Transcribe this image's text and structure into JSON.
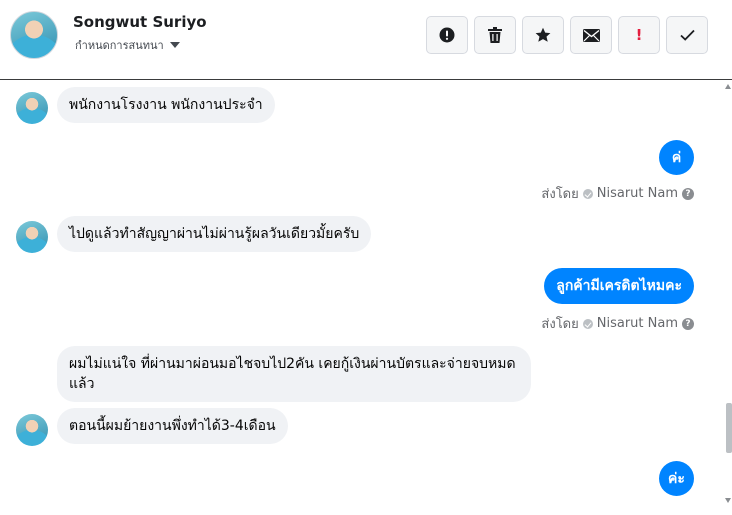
{
  "header": {
    "contact_name": "Songwut Suriyo",
    "subtitle": "กำหนดการสนทนา",
    "actions": [
      {
        "name": "report-button",
        "icon": "exclamation-circle-icon"
      },
      {
        "name": "delete-button",
        "icon": "trash-icon"
      },
      {
        "name": "star-button",
        "icon": "star-icon"
      },
      {
        "name": "mark-unread-button",
        "icon": "envelope-icon"
      },
      {
        "name": "flag-button",
        "icon": "exclamation-icon",
        "label": "!",
        "color": "#e41e3f"
      },
      {
        "name": "mark-done-button",
        "icon": "checkmark-icon"
      }
    ]
  },
  "messages": [
    {
      "from": "contact",
      "text": "พนักงานโรงงาน พนักงานประจำ"
    },
    {
      "from": "page",
      "text": "ค่"
    },
    {
      "from": "page_meta",
      "prefix": "ส่งโดย",
      "author": "Nisarut Nam"
    },
    {
      "from": "contact",
      "text": "ไปดูแล้วทำสัญญาผ่านไม่ผ่านรู้ผลวันเดียวมั้ยครับ"
    },
    {
      "from": "page",
      "text": "ลูกค้ามีเครดิตไหมคะ"
    },
    {
      "from": "page_meta",
      "prefix": "ส่งโดย",
      "author": "Nisarut Nam"
    },
    {
      "from": "contact",
      "text": "ผมไม่แน่ใจ ที่ผ่านมาผ่อนมอไชจบไป2คัน เคยกู้เงินผ่านบัตรและจ่ายจบหมดแล้ว"
    },
    {
      "from": "contact",
      "text": "ตอนนี้ผมย้ายงานพึ่งทำได้3-4เดือน"
    },
    {
      "from": "page",
      "text": "ค่ะ"
    }
  ],
  "colors": {
    "outgoing_bubble": "#0084ff",
    "incoming_bubble": "#f0f2f5",
    "flag": "#e41e3f"
  }
}
